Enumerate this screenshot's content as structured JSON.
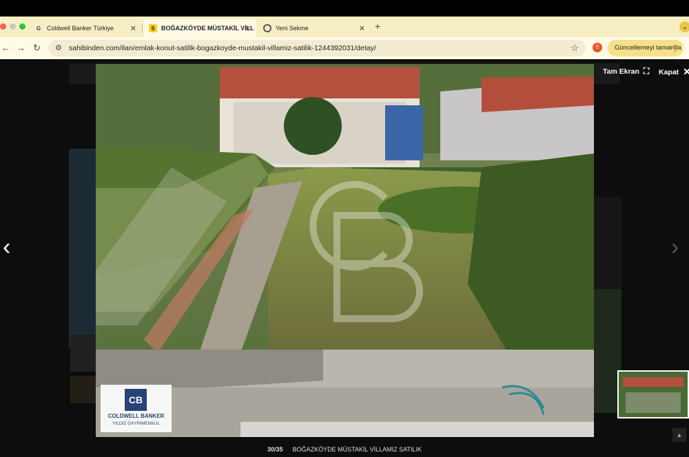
{
  "browser": {
    "tabs": [
      {
        "label": "Coldwell Banker Türkiye",
        "icon": "coldwell-favicon"
      },
      {
        "label": "BOĞAZKÖYDE MÜSTAKİL VİLL",
        "icon": "sahibinden-favicon",
        "favicon_text": "S"
      },
      {
        "label": "Yeni Sekme",
        "icon": "chrome-favicon"
      }
    ],
    "new_tab": "+",
    "url": "sahibinden.com/ilan/emlak-konut-satilik-bogazkoyde-mustakil-villamiz-satilik-1244392031/detay/",
    "update_button": "Güncellemeyi tamamla",
    "extension_badge": "!!"
  },
  "viewer": {
    "fullscreen_label": "Tam Ekran",
    "close_label": "Kapat",
    "counter": "30/35",
    "title": "BOĞAZKÖYDE MÜSTAKİL VİLLAMIZ SATILIK"
  },
  "watermark": {
    "logo_lines": [
      "COLDWELL BANKER",
      "YILDIZ GAYRİMENKUL"
    ],
    "monogram": "CB"
  },
  "colors": {
    "tabbar": "#f7efc3",
    "toolbar": "#fffbe6",
    "overlay": "#0d0d0d",
    "brand_blue": "#1f3b73"
  }
}
